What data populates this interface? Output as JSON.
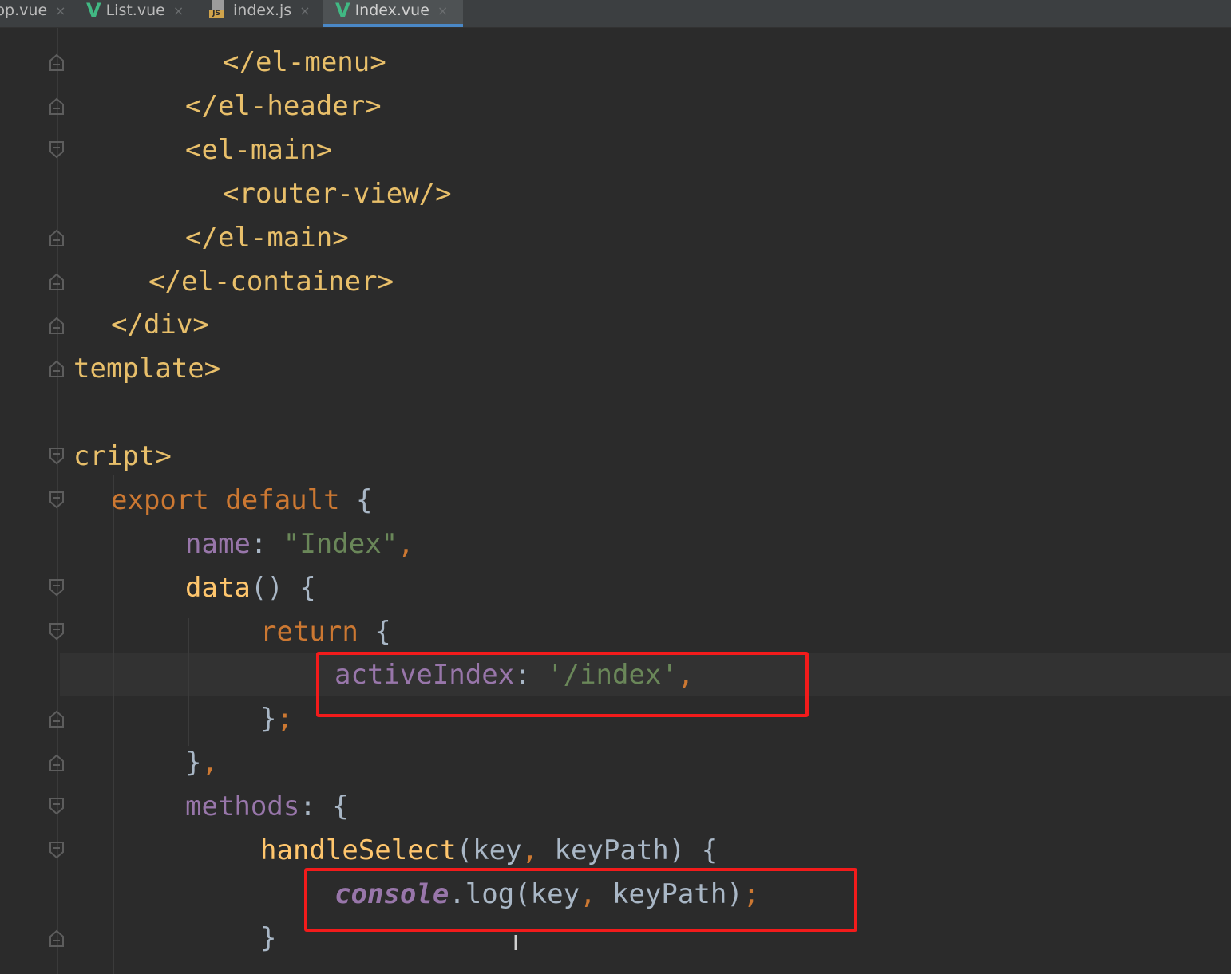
{
  "tabs": [
    {
      "label": "pp.vue",
      "icon": "vue-icon",
      "active": false
    },
    {
      "label": "List.vue",
      "icon": "vue-icon",
      "active": false
    },
    {
      "label": "index.js",
      "icon": "js-file-icon",
      "active": false
    },
    {
      "label": "Index.vue",
      "icon": "vue-icon",
      "active": true
    }
  ],
  "icons": {
    "vue": "V",
    "close": "×",
    "js_badge": "JS",
    "text_cursor": "I"
  },
  "colors": {
    "background": "#2b2b2b",
    "tag": "#e8bf6a",
    "keyword": "#cc7832",
    "property": "#9876aa",
    "string": "#6a8759",
    "function": "#ffc66d",
    "plain": "#a9b7c6",
    "highlight_box": "#f21b1b",
    "active_tab_underline": "#4a88c7"
  },
  "code": {
    "l1": "</el-menu>",
    "l2": "</el-header>",
    "l3": "<el-main>",
    "l4": "<router-view/>",
    "l5": "</el-main>",
    "l6": "</el-container>",
    "l7": "</div>",
    "l8": "template>",
    "l9": "cript>",
    "l10_kw": "export default",
    "l10_brace": " {",
    "l11_key": "name",
    "l11_colon": ": ",
    "l11_str": "\"Index\"",
    "l11_comma": ",",
    "l12_fn": "data",
    "l12_rest": "() {",
    "l13_kw": "return",
    "l13_brace": " {",
    "l14_key": "activeIndex",
    "l14_colon": ": ",
    "l14_str": "'/index'",
    "l14_comma": ",",
    "l15_brace": "}",
    "l15_semi": ";",
    "l16_brace": "}",
    "l16_comma": ",",
    "l17_key": "methods",
    "l17_rest": ": {",
    "l18_fn": "handleSelect",
    "l18_p1": "(key",
    "l18_comma": ",",
    "l18_p2": " keyPath) {",
    "l19_console": "console",
    "l19_log": ".log(key",
    "l19_comma": ",",
    "l19_p2": " keyPath)",
    "l19_semi": ";",
    "l20_brace": "}"
  }
}
